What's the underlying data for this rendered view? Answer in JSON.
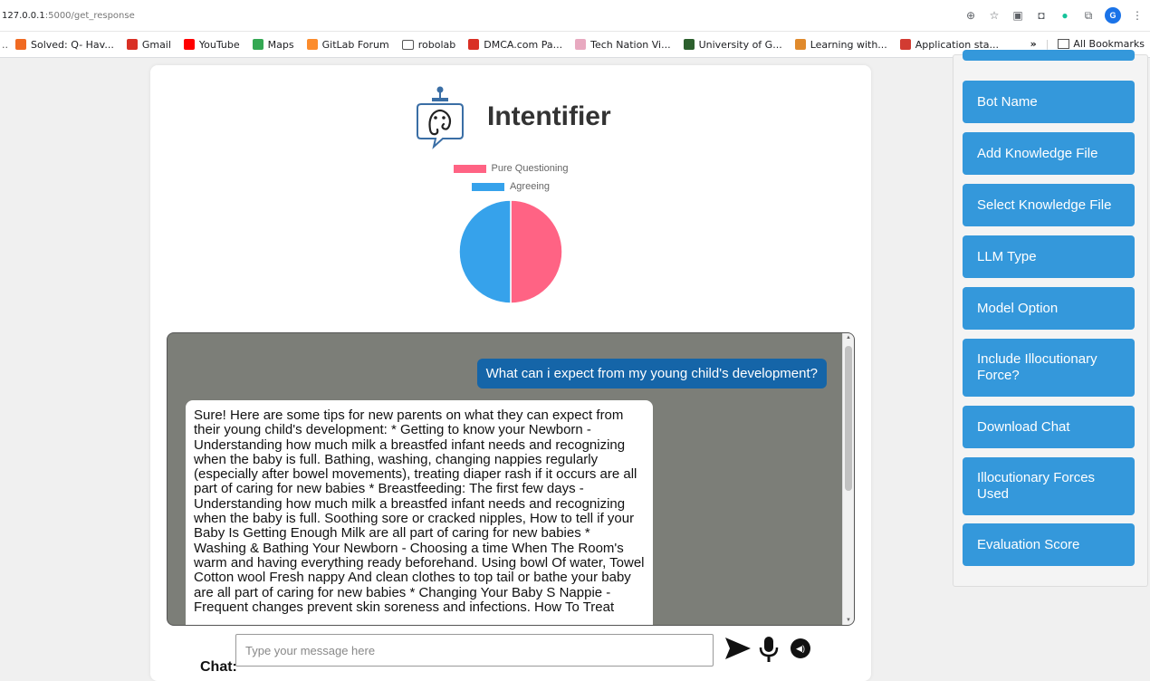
{
  "browser": {
    "url_host": "127.0.0.1",
    "url_path": ":5000/get_response",
    "bookmarks": [
      {
        "label": "Solved: Q- Hav...",
        "icon": "coursera-icon",
        "color": "#f06a22"
      },
      {
        "label": "Gmail",
        "icon": "gmail-icon",
        "color": "#d93025"
      },
      {
        "label": "YouTube",
        "icon": "youtube-icon",
        "color": "#ff0000"
      },
      {
        "label": "Maps",
        "icon": "maps-icon",
        "color": "#34a853"
      },
      {
        "label": "GitLab Forum",
        "icon": "gitlab-icon",
        "color": "#fc8c2c"
      },
      {
        "label": "robolab",
        "icon": "folder-icon",
        "color": "#ffffff"
      },
      {
        "label": "DMCA.com Pa...",
        "icon": "gmail-icon",
        "color": "#d93025"
      },
      {
        "label": "Tech Nation Vi...",
        "icon": "tech-nation-icon",
        "color": "#e8a9c0"
      },
      {
        "label": "University of G...",
        "icon": "university-icon",
        "color": "#2c5f2d"
      },
      {
        "label": "Learning with...",
        "icon": "learning-icon",
        "color": "#e08a2c"
      },
      {
        "label": "Application sta...",
        "icon": "application-icon",
        "color": "#d23b32"
      }
    ],
    "all_bookmarks": "All Bookmarks",
    "profile_initial": "G"
  },
  "app": {
    "title": "Intentifier"
  },
  "chart_data": {
    "type": "pie",
    "title": "",
    "series": [
      {
        "name": "Pure Questioning",
        "value": 50,
        "color": "#ff6384"
      },
      {
        "name": "Agreeing",
        "value": 50,
        "color": "#36a2eb"
      }
    ],
    "legend_position": "top"
  },
  "chat": {
    "user_message": "What can i expect from my young child's development?",
    "bot_message": "Sure! Here are some tips for new parents on what they can expect from their young child's development: * Getting to know your Newborn - Understanding how much milk a breastfed infant needs and recognizing when the baby is full. Bathing, washing, changing nappies regularly (especially after bowel movements), treating diaper rash if it occurs are all part of caring for new babies * Breastfeeding: The first few days - Understanding how much milk a breastfed infant needs and recognizing when the baby is full. Soothing sore or cracked nipples, How to tell if your Baby Is Getting Enough Milk are all part of caring for new babies * Washing & Bathing Your Newborn - Choosing a time When The Room's warm and having everything ready beforehand. Using bowl Of water, Towel Cotton wool Fresh nappy And clean clothes to top tail or bathe your baby are all part of caring for new babies * Changing Your Baby S Nappie - Frequent changes prevent skin soreness and infections. How To Treat",
    "label": "Chat:",
    "placeholder": "Type your message here"
  },
  "sidebar": {
    "buttons": [
      {
        "label": "Bot Name"
      },
      {
        "label": "Add Knowledge File"
      },
      {
        "label": "Select Knowledge File"
      },
      {
        "label": "LLM Type"
      },
      {
        "label": "Model Option"
      },
      {
        "label": "Include Illocutionary Force?"
      },
      {
        "label": "Download Chat"
      },
      {
        "label": "Illocutionary Forces Used"
      },
      {
        "label": "Evaluation Score"
      }
    ]
  },
  "colors": {
    "accent": "#3498db",
    "user_bubble": "#1565a8",
    "chat_bg": "#7c7e78"
  }
}
